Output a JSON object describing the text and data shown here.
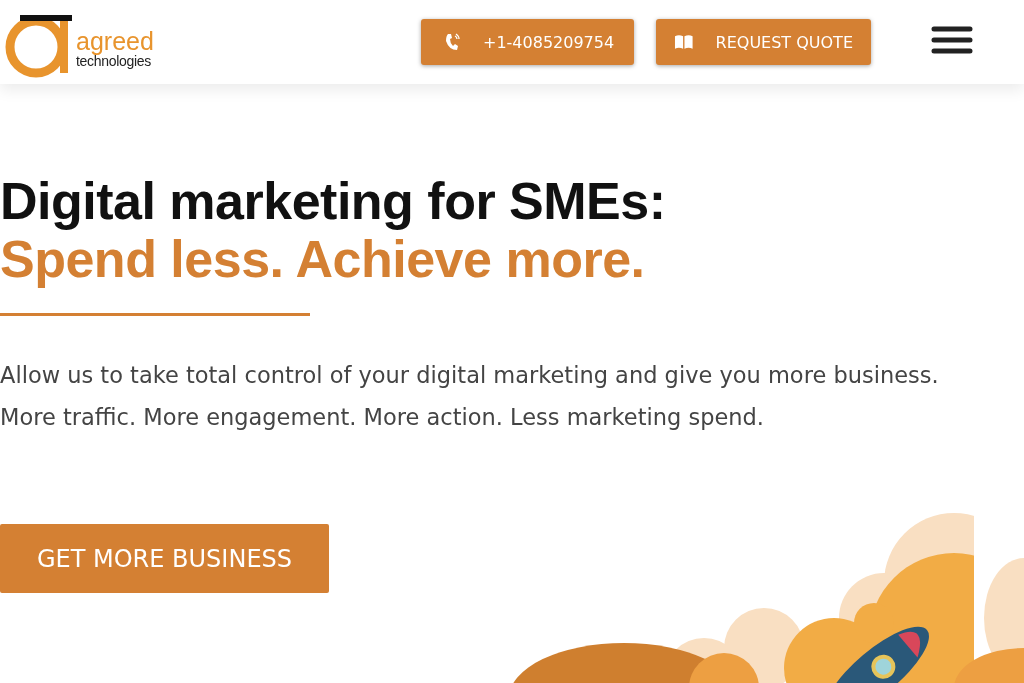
{
  "header": {
    "logo": {
      "word": "agreed",
      "subword": "technologies"
    },
    "buttons": [
      {
        "kind": "phone",
        "label": "+1-4085209754"
      },
      {
        "kind": "book",
        "label": "REQUEST QUOTE"
      }
    ]
  },
  "hero": {
    "title": "Digital marketing for SMEs:",
    "subtitle": "Spend less. Achieve more.",
    "paragraphs": [
      "Allow us to take total control of your digital marketing and give you more business.",
      "More traffic. More engagement. More action. Less marketing spend."
    ],
    "cta": "GET MORE BUSINESS"
  }
}
